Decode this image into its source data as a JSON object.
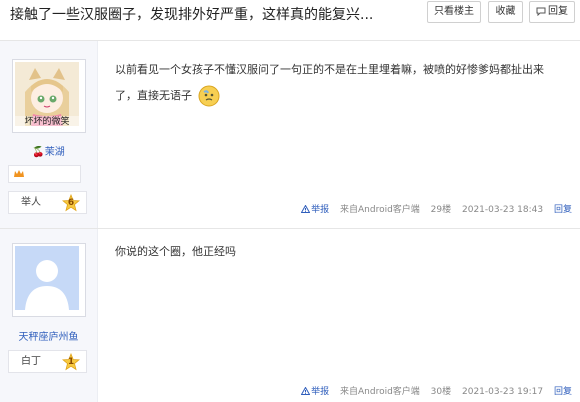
{
  "thread": {
    "title": "接触了一些汉服圈子，发现排外好严重，这样真的能复兴...",
    "buttons": {
      "only_op": "只看楼主",
      "favorite": "收藏",
      "reply": "回复"
    }
  },
  "posts": [
    {
      "author": "🍒茉湖",
      "avatar_caption": "坏坏的微笑",
      "level_name": "举人",
      "level": "6",
      "content": "以前看见一个女孩子不懂汉服问了一句正的不是在土里埋着嘛，被喷的好惨爹妈都扯出来了，直接无语子",
      "meta": {
        "report": "举报",
        "source": "来自Android客户端",
        "floor": "29楼",
        "time": "2021-03-23 18:43",
        "reply": "回复"
      }
    },
    {
      "author": "天秤座庐州鱼",
      "level_name": "白丁",
      "level": "1",
      "content": "你说的这个圈，他正经吗",
      "meta": {
        "report": "举报",
        "source": "来自Android客户端",
        "floor": "30楼",
        "time": "2021-03-23 19:17",
        "reply": "回复"
      }
    }
  ]
}
